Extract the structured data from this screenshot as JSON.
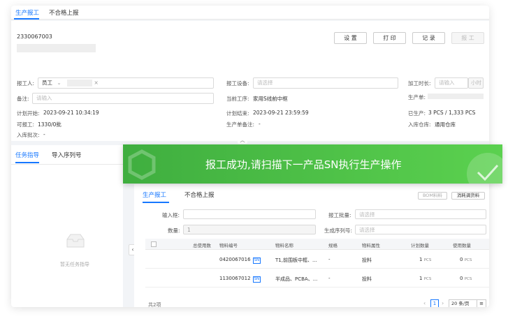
{
  "tabs": {
    "production_report": "生产报工",
    "defect_report": "不合格上报"
  },
  "order": {
    "number": "2330067003"
  },
  "buttons": {
    "settings": "设 置",
    "print": "打 印",
    "record": "记 录",
    "report": "报 工"
  },
  "form": {
    "reporter_label": "报工人:",
    "reporter_type": "员工",
    "remark_label": "备注:",
    "remark_placeholder": "请输入",
    "device_label": "报工设备:",
    "device_placeholder": "请选择",
    "duration_label": "加工时长:",
    "duration_placeholder": "请输入",
    "duration_unit": "小时",
    "current_process_label": "当前工序:",
    "current_process_value": "家用S线前中框",
    "production_order_label": "生产单:",
    "plan_start_label": "计划开始:",
    "plan_start_value": "2023-09-21 10:34:19",
    "plan_end_label": "计划结束:",
    "plan_end_value": "2023-09-21 23:59:59",
    "produced_label": "已生产:",
    "produced_value": "3 PCS / 1,333 PCS",
    "reportable_label": "可报工:",
    "reportable_value": "1330/0批",
    "order_remark_label": "生产单备注:",
    "order_remark_value": "-",
    "warehouse_label": "入库仓库:",
    "warehouse_value": "通用仓库",
    "batch_label": "入库批次:",
    "batch_value": "-"
  },
  "left_tabs": {
    "task_guide": "任务指导",
    "import_serial": "导入序列号"
  },
  "empty_text": "暂无任务指导",
  "toast": {
    "message": "报工成功,请扫描下一产品SN执行生产操作"
  },
  "sub": {
    "tab_report": "生产报工",
    "tab_defect": "不合格上报",
    "bom_btn": "BOM料料",
    "consume_btn": "消耗调货料",
    "input_label": "输入框:",
    "qty_label": "数量:",
    "qty_value": "1",
    "batch_label": "报工批量:",
    "batch_placeholder": "请选择",
    "serial_label": "生成序列号:",
    "serial_placeholder": "请选择"
  },
  "table": {
    "headers": [
      "总使用数",
      "物料编号",
      "物料名称",
      "规格",
      "物料属性",
      "计划数量",
      "使用数量"
    ],
    "rows": [
      {
        "code": "0420067016",
        "tag": "SN",
        "name": "T1,前围板中框、...",
        "spec": "-",
        "attr": "投料",
        "plan": "1",
        "plan_unit": "PCS",
        "used": "0",
        "used_unit": "PCS"
      },
      {
        "code": "1130067012",
        "tag": "SN",
        "name": "半成品、PCBA、...",
        "spec": "-",
        "attr": "投料",
        "plan": "1",
        "plan_unit": "PCS",
        "used": "0",
        "used_unit": "PCS"
      }
    ],
    "total": "共2项",
    "page": "1",
    "page_size": "20 条/页"
  }
}
